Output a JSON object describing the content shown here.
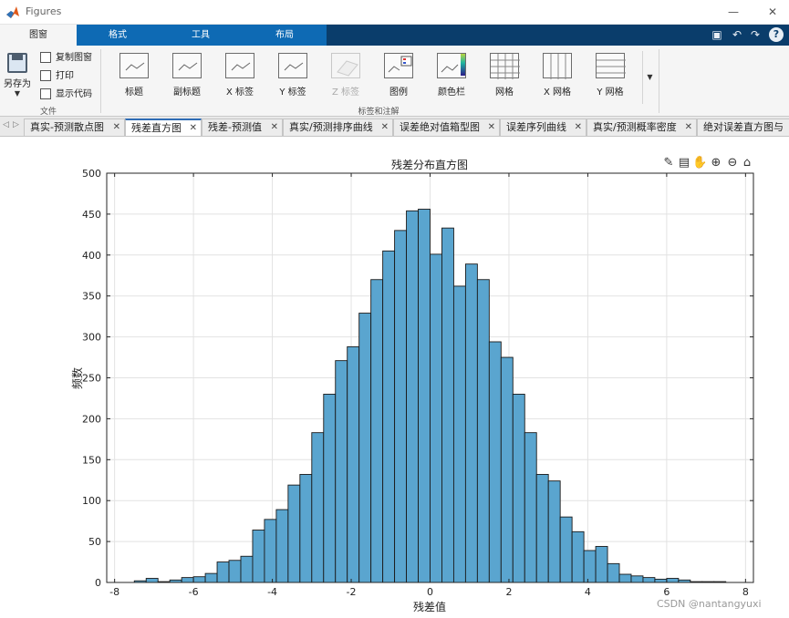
{
  "window": {
    "title": "Figures"
  },
  "toolstrip_tabs": [
    "图窗",
    "格式",
    "工具",
    "布局"
  ],
  "file_group": {
    "save_as_label": "另存为",
    "copy_label": "复制图窗",
    "print_label": "打印",
    "show_code_label": "显示代码",
    "group_label": "文件"
  },
  "annotation_group": {
    "buttons": [
      "标题",
      "副标题",
      "X 标签",
      "Y 标签",
      "Z 标签",
      "图例",
      "颜色栏",
      "网格",
      "X 网格",
      "Y 网格"
    ],
    "group_label": "标签和注解"
  },
  "document_tabs": [
    {
      "label": "真实-预测散点图",
      "active": false
    },
    {
      "label": "残差直方图",
      "active": true
    },
    {
      "label": "残差-预测值",
      "active": false
    },
    {
      "label": "真实/预测排序曲线",
      "active": false
    },
    {
      "label": "误差绝对值箱型图",
      "active": false
    },
    {
      "label": "误差序列曲线",
      "active": false
    },
    {
      "label": "真实/预测概率密度",
      "active": false
    },
    {
      "label": "绝对误差直方图与",
      "active": false
    }
  ],
  "colors": {
    "bar_fill": "#5aa5cf",
    "bar_edge": "#1a1a1a",
    "accent": "#0e6ab4"
  },
  "chart_data": {
    "type": "bar",
    "title": "残差分布直方图",
    "xlabel": "残差值",
    "ylabel": "频数",
    "xlim": [
      -8.2,
      8.2
    ],
    "ylim": [
      0,
      500
    ],
    "xticks": [
      -8,
      -6,
      -4,
      -2,
      0,
      2,
      4,
      6,
      8
    ],
    "yticks": [
      0,
      50,
      100,
      150,
      200,
      250,
      300,
      350,
      400,
      450,
      500
    ],
    "grid": true,
    "bin_edges_start": -7.5,
    "bin_width": 0.3,
    "values": [
      2,
      5,
      1,
      3,
      6,
      7,
      11,
      25,
      27,
      32,
      64,
      77,
      89,
      119,
      132,
      183,
      230,
      271,
      288,
      329,
      370,
      405,
      430,
      454,
      456,
      401,
      433,
      362,
      389,
      370,
      294,
      275,
      230,
      183,
      132,
      124,
      80,
      62,
      39,
      44,
      23,
      10,
      8,
      6,
      4,
      5,
      3,
      1,
      1,
      1
    ]
  },
  "watermark": "CSDN @nantangyuxi"
}
